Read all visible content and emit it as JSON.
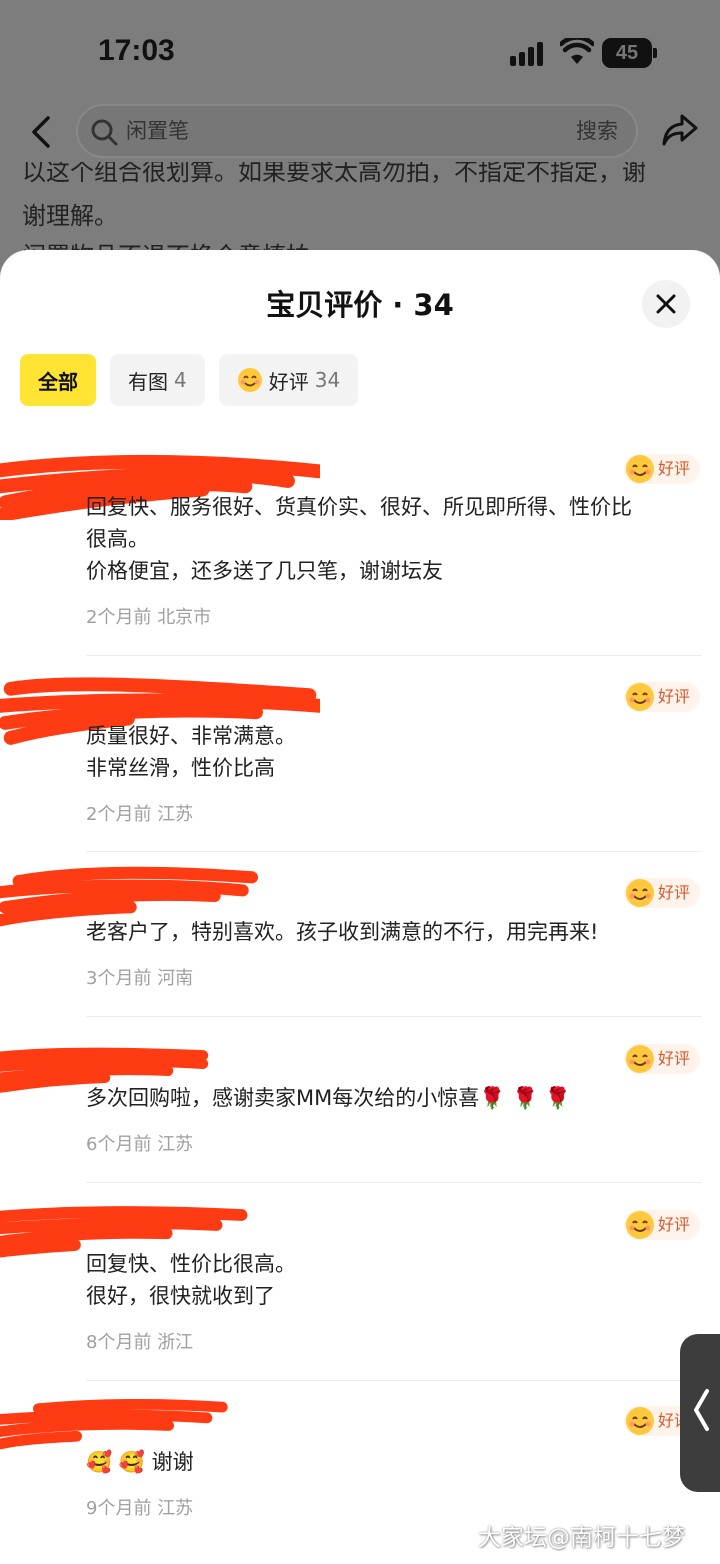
{
  "status_bar": {
    "time": "17:03",
    "battery": "45"
  },
  "nav": {
    "search_placeholder": "闲置笔",
    "search_button": "搜索"
  },
  "background_text": {
    "line1": "以这个组合很划算。如果要求太高勿拍，不指定不指定，谢",
    "line2": "谢理解。",
    "line3": "闲置物品不退不换介意慎拍"
  },
  "sheet": {
    "title": "宝贝评价 · 34",
    "filters": [
      {
        "label": "全部",
        "count": ""
      },
      {
        "label": "有图",
        "count": "4"
      },
      {
        "label": "好评",
        "count": "34"
      }
    ]
  },
  "badge_label": "好评",
  "reviews": [
    {
      "text": "回复快、服务很好、货真价实、很好、所见即所得、性价比\n很高。\n价格便宜，还多送了几只笔，谢谢坛友",
      "time": "2个月前",
      "location": "北京市"
    },
    {
      "text": "质量很好、非常满意。\n非常丝滑，性价比高",
      "time": "2个月前",
      "location": "江苏"
    },
    {
      "text": "老客户了，特别喜欢。孩子收到满意的不行，用完再来!",
      "time": "3个月前",
      "location": "河南"
    },
    {
      "text": "多次回购啦，感谢卖家MM每次给的小惊喜🌹 🌹 🌹",
      "time": "6个月前",
      "location": "江苏"
    },
    {
      "text": "回复快、性价比很高。\n很好，很快就收到了",
      "time": "8个月前",
      "location": "浙江"
    },
    {
      "text": "🥰 🥰 谢谢",
      "time": "9个月前",
      "location": "江苏"
    }
  ],
  "watermark": "大家坛@南柯十七梦",
  "colors": {
    "accent": "#ffe433",
    "redaction": "#ff3b14",
    "badge_text": "#d85a2a"
  }
}
